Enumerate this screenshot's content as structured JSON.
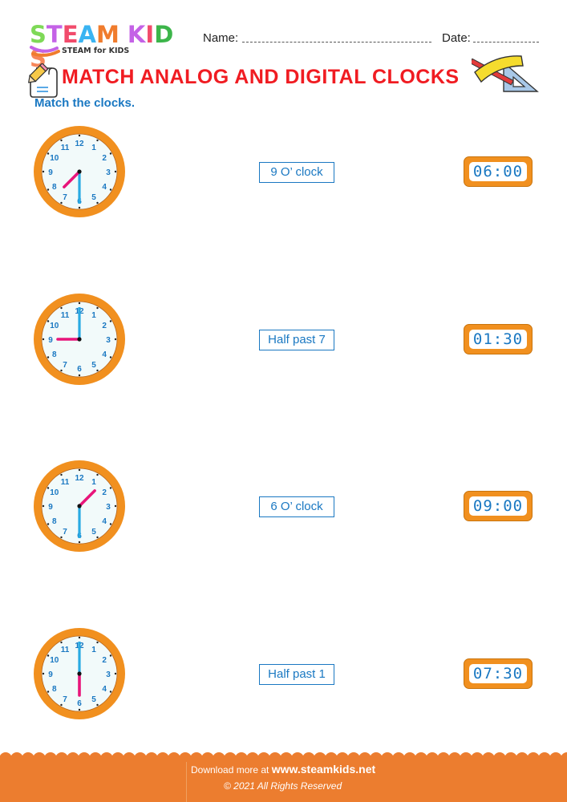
{
  "header": {
    "logo": {
      "letters": [
        {
          "char": "S",
          "color": "#7ed957"
        },
        {
          "char": "T",
          "color": "#c462e6"
        },
        {
          "char": "E",
          "color": "#f14b6b"
        },
        {
          "char": "A",
          "color": "#3ab4f2"
        },
        {
          "char": "M",
          "color": "#f07c2d"
        },
        {
          "char": " ",
          "color": "#ffffff"
        },
        {
          "char": "K",
          "color": "#c462e6"
        },
        {
          "char": "I",
          "color": "#f14b6b"
        },
        {
          "char": "D",
          "color": "#3cb54a"
        },
        {
          "char": "S",
          "color": "#f7875a"
        }
      ],
      "tagline": "STEAM for KIDS"
    },
    "name_label": "Name:",
    "date_label": "Date:"
  },
  "worksheet": {
    "title": "MATCH ANALOG AND DIGITAL CLOCKS",
    "instruction": "Match the clocks.",
    "rows": [
      {
        "analog": {
          "hour": 7,
          "minute": 30
        },
        "label": "9 O’ clock",
        "digital": "06:00"
      },
      {
        "analog": {
          "hour": 9,
          "minute": 0
        },
        "label": "Half past 7",
        "digital": "01:30"
      },
      {
        "analog": {
          "hour": 1,
          "minute": 30
        },
        "label": "6 O’ clock",
        "digital": "09:00"
      },
      {
        "analog": {
          "hour": 6,
          "minute": 0
        },
        "label": "Half past 1",
        "digital": "07:30"
      }
    ],
    "clock_numbers": [
      "12",
      "1",
      "2",
      "3",
      "4",
      "5",
      "6",
      "7",
      "8",
      "9",
      "10",
      "11"
    ]
  },
  "footer": {
    "download_text": "Download more at",
    "site": "www.steamkids.net",
    "copyright": "© 2021 All Rights Reserved"
  },
  "colors": {
    "accent_orange": "#f1901f",
    "title_red": "#f01c22",
    "text_blue": "#1a78c2",
    "hour_hand": "#e8157a",
    "minute_hand": "#29aae2",
    "footer_bg": "#ec7d2f"
  }
}
